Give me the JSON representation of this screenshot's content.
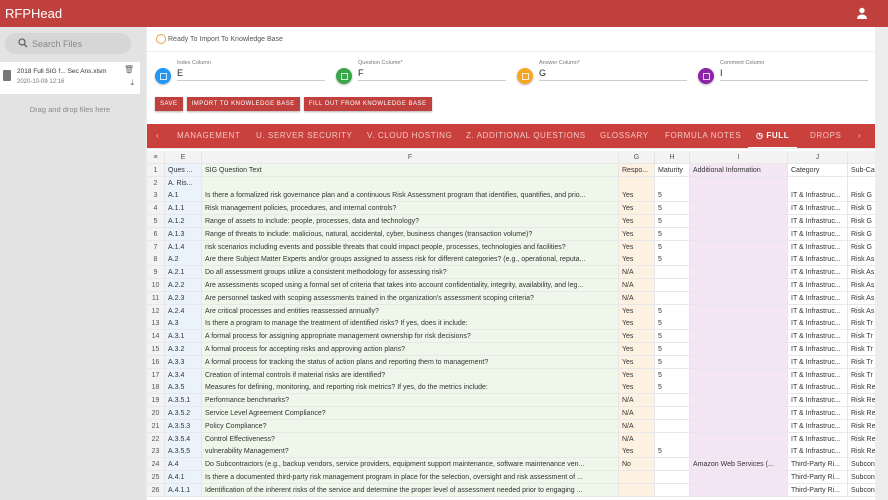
{
  "app": {
    "title": "RFPHead"
  },
  "sidebar": {
    "search_placeholder": "Search Files",
    "file": {
      "name": "2018 Full SIG f... Sec Ans.xlsm",
      "date": "2020-10-09 12:16"
    },
    "drop_text": "Drag and drop files here"
  },
  "status": {
    "text": "Ready To Import To Knowledge Base"
  },
  "fields": [
    {
      "label": "Index Column",
      "value": "E",
      "color": "#2196f3"
    },
    {
      "label": "Question Column*",
      "value": "F",
      "color": "#3aa64a"
    },
    {
      "label": "Answer Column*",
      "value": "G",
      "color": "#f5a623"
    },
    {
      "label": "Comment Column",
      "value": "I",
      "color": "#8e24aa"
    }
  ],
  "buttons": {
    "save": "SAVE",
    "import": "IMPORT TO KNOWLEDGE BASE",
    "fill": "FILL OUT FROM KNOWLEDGE BASE"
  },
  "tabs": [
    "MANAGEMENT",
    "U. SERVER SECURITY",
    "V. CLOUD HOSTING",
    "Z. ADDITIONAL QUESTIONS",
    "GLOSSARY",
    "FORMULA NOTES",
    "FULL",
    "DROPS"
  ],
  "active_tab": "FULL",
  "grid": {
    "columns": [
      "E",
      "F",
      "G",
      "H",
      "I",
      "J",
      ""
    ],
    "rows": [
      [
        "Ques ...",
        "SIG Question Text",
        "Respo...",
        "Maturity",
        "Additional Information",
        "Category",
        "Sub-Ca"
      ],
      [
        "A. Ris...",
        "",
        "",
        "",
        "",
        "",
        ""
      ],
      [
        "A.1",
        "Is there a formalized risk governance plan and a continuous Risk Assessment program that identifies, quantifies, and prio...",
        "Yes",
        "5",
        "",
        "IT & Infrastruc...",
        "Risk G"
      ],
      [
        "A.1.1",
        "Risk management policies, procedures, and internal controls?",
        "Yes",
        "5",
        "",
        "IT & Infrastruc...",
        "Risk G"
      ],
      [
        "A.1.2",
        "Range of assets to include: people, processes, data and technology?",
        "Yes",
        "5",
        "",
        "IT & Infrastruc...",
        "Risk G"
      ],
      [
        "A.1.3",
        "Range of threats to include: malicious, natural, accidental, cyber, business changes (transaction volume)?",
        "Yes",
        "5",
        "",
        "IT & Infrastruc...",
        "Risk G"
      ],
      [
        "A.1.4",
        "risk scenarios including events and possible threats that could impact people, processes, technologies and facilities?",
        "Yes",
        "5",
        "",
        "IT & Infrastruc...",
        "Risk G"
      ],
      [
        "A.2",
        "Are there Subject Matter Experts and/or groups assigned to assess risk for different categories? (e.g., operational, reputa...",
        "Yes",
        "5",
        "",
        "IT & Infrastruc...",
        "Risk As"
      ],
      [
        "A.2.1",
        "Do all assessment groups utilize a consistent methodology for assessing risk?",
        "N/A",
        "",
        "",
        "IT & Infrastruc...",
        "Risk As"
      ],
      [
        "A.2.2",
        "Are assessments scoped using a formal set of criteria that takes into account confidentiality, integrity, availability, and leg...",
        "N/A",
        "",
        "",
        "IT & Infrastruc...",
        "Risk As"
      ],
      [
        "A.2.3",
        "Are personnel tasked with scoping assessments trained in the organization's assessment scoping criteria?",
        "N/A",
        "",
        "",
        "IT & Infrastruc...",
        "Risk As"
      ],
      [
        "A.2.4",
        "Are critical processes and entities reassessed annually?",
        "Yes",
        "5",
        "",
        "IT & Infrastruc...",
        "Risk As"
      ],
      [
        "A.3",
        "Is there a program to manage the treatment of identified risks? If yes, does it include:",
        "Yes",
        "5",
        "",
        "IT & Infrastruc...",
        "Risk Tr"
      ],
      [
        "A.3.1",
        "A formal process for assigning appropriate management ownership for risk decisions?",
        "Yes",
        "5",
        "",
        "IT & Infrastruc...",
        "Risk Tr"
      ],
      [
        "A.3.2",
        "A formal process for accepting risks and approving action plans?",
        "Yes",
        "5",
        "",
        "IT & Infrastruc...",
        "Risk Tr"
      ],
      [
        "A.3.3",
        "A formal process for tracking the status of action plans and reporting them to management?",
        "Yes",
        "5",
        "",
        "IT & Infrastruc...",
        "Risk Tr"
      ],
      [
        "A.3.4",
        "Creation of internal controls if material risks are identified?",
        "Yes",
        "5",
        "",
        "IT & Infrastruc...",
        "Risk Tr"
      ],
      [
        "A.3.5",
        "Measures for defining, monitoring, and reporting risk metrics? If yes, do the metrics include:",
        "Yes",
        "5",
        "",
        "IT & Infrastruc...",
        "Risk Re"
      ],
      [
        "A.3.5.1",
        "Performance benchmarks?",
        "N/A",
        "",
        "",
        "IT & Infrastruc...",
        "Risk Re"
      ],
      [
        "A.3.5.2",
        "Service Level Agreement Compliance?",
        "N/A",
        "",
        "",
        "IT & Infrastruc...",
        "Risk Re"
      ],
      [
        "A.3.5.3",
        "Policy Compliance?",
        "N/A",
        "",
        "",
        "IT & Infrastruc...",
        "Risk Re"
      ],
      [
        "A.3.5.4",
        "Control Effectiveness?",
        "N/A",
        "",
        "",
        "IT & Infrastruc...",
        "Risk Re"
      ],
      [
        "A.3.5.5",
        "vulnerability Management?",
        "Yes",
        "5",
        "",
        "IT & Infrastruc...",
        "Risk Re"
      ],
      [
        "A.4",
        "Do Subcontractors (e.g., backup vendors, service providers, equipment support maintenance, software maintenance ven...",
        "No",
        "",
        "Amazon Web Services (...",
        "Third-Party Ri...",
        "Subcon"
      ],
      [
        "A.4.1",
        "Is there a documented third-party risk management program in place for the selection, oversight and risk assessment of ...",
        "",
        "",
        "",
        "Third-Party Ri...",
        "Subcon"
      ],
      [
        "A.4.1.1",
        "Identification of the inherent risks of the service and determine the proper level of assessment needed prior to engaging ...",
        "",
        "",
        "",
        "Third-Party Ri...",
        "Subcon"
      ]
    ]
  }
}
